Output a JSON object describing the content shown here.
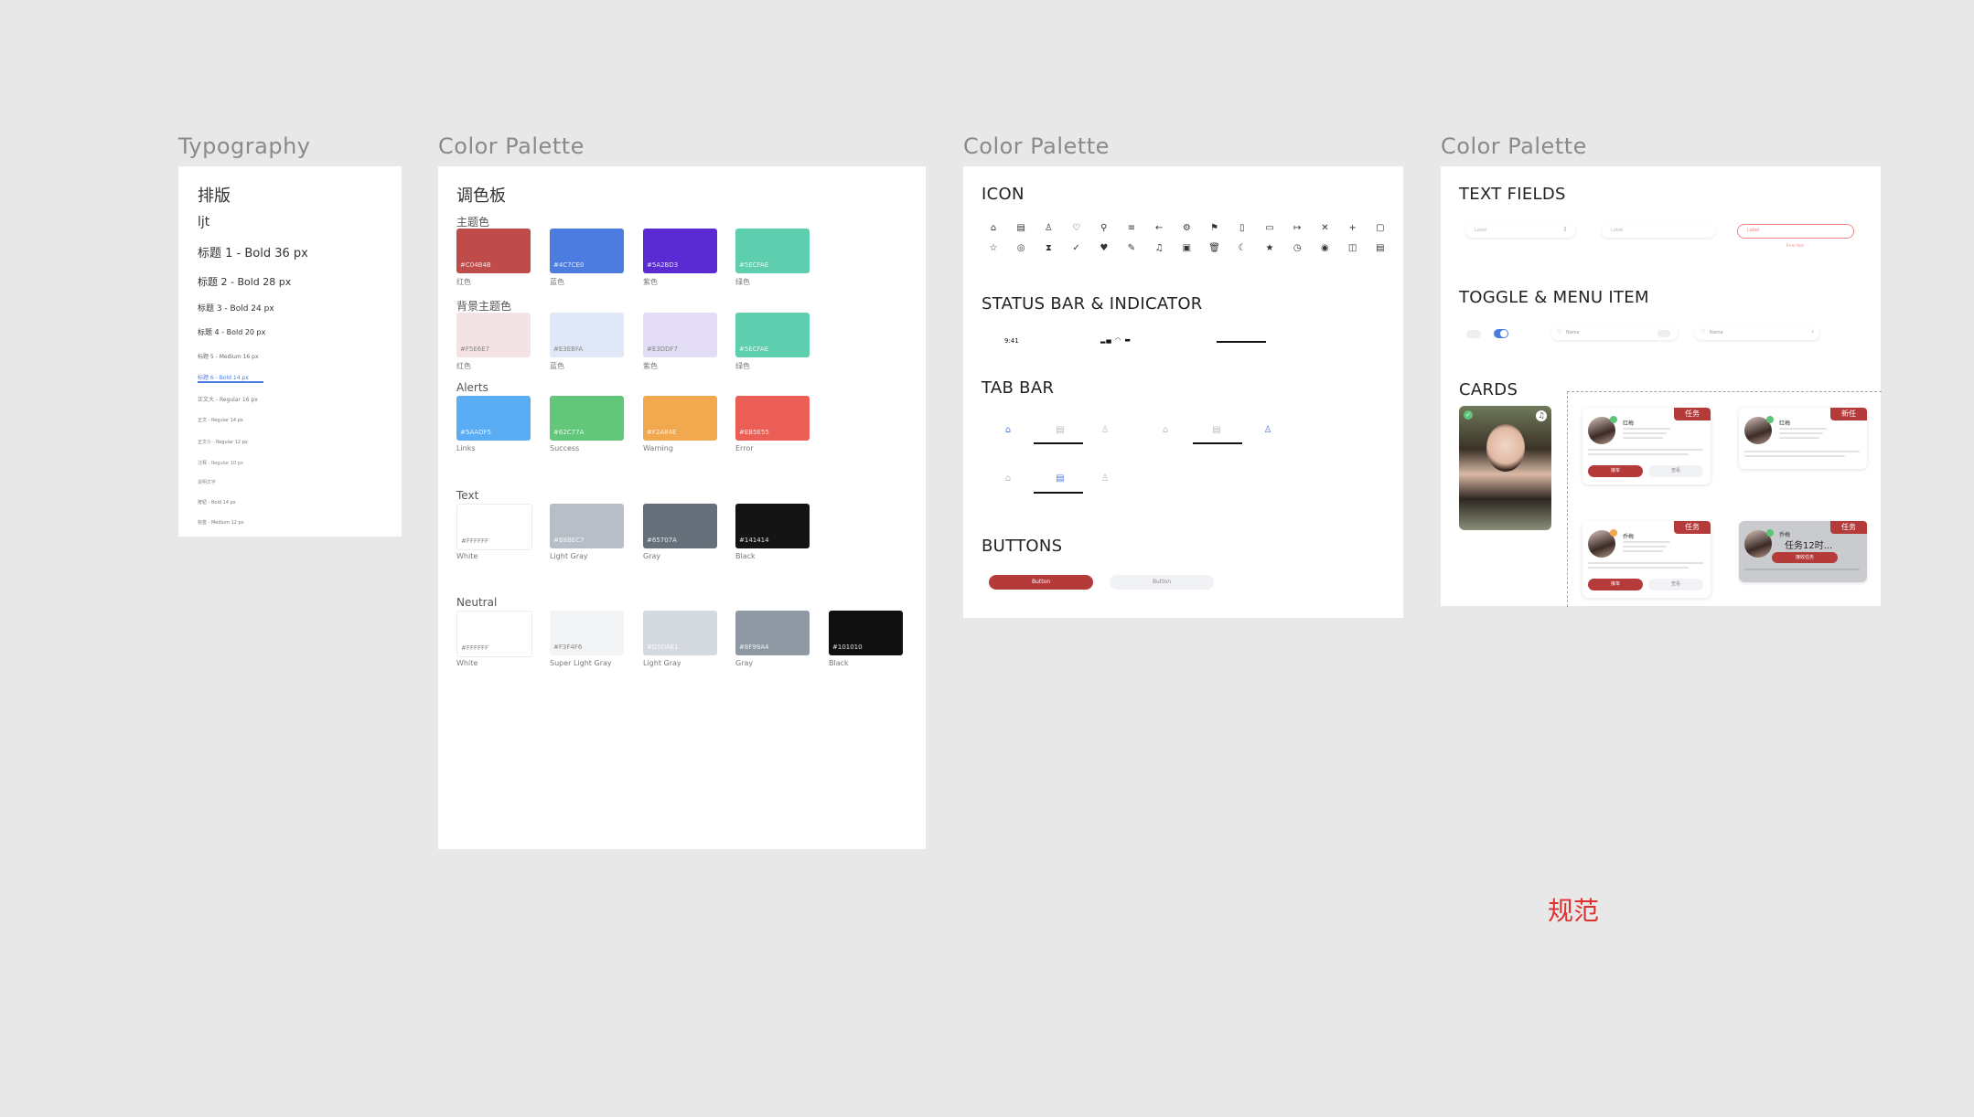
{
  "frames": {
    "typography_title": "Typography",
    "palette_title": "Color Palette",
    "components_title": "Color Palette",
    "forms_title": "Color Palette"
  },
  "typography": {
    "heading": "排版",
    "sample": "ljt",
    "lines": [
      "标题 1 - Bold 36 px",
      "标题 2 - Bold 28 px",
      "标题 3 - Bold 24 px",
      "标题 4 - Bold 20 px",
      "标题 5 - Medium 16 px",
      "标题 6 - Bold 14 px",
      "正文大 - Regular 16 px",
      "正文 - Regular 14 px",
      "正文小 - Regular 12 px",
      "注释 - Regular 10 px",
      "说明文字",
      "按钮 - Bold 14 px",
      "标签 - Medium 12 px"
    ]
  },
  "palette": {
    "heading": "调色板",
    "sections": [
      {
        "label": "主题色",
        "swatches": [
          {
            "hex": "#C04B4B",
            "name": "红色",
            "color": "#c04b4b"
          },
          {
            "hex": "#4C7CE0",
            "name": "蓝色",
            "color": "#4c7ce0"
          },
          {
            "hex": "#5A2BD3",
            "name": "紫色",
            "color": "#5a2bd3"
          },
          {
            "hex": "#5ECFAE",
            "name": "绿色",
            "color": "#5ecfae"
          }
        ]
      },
      {
        "label": "背景主题色",
        "swatches": [
          {
            "hex": "#F5E6E7",
            "name": "红色",
            "color": "#f3e3e4"
          },
          {
            "hex": "#E3EBFA",
            "name": "蓝色",
            "color": "#e0e8f7"
          },
          {
            "hex": "#E3DDF7",
            "name": "紫色",
            "color": "#e2dcf4"
          },
          {
            "hex": "#5ECFAE",
            "name": "绿色",
            "color": "#5ecfae"
          }
        ]
      },
      {
        "label": "Alerts",
        "swatches": [
          {
            "hex": "#5AADF5",
            "name": "Links",
            "color": "#5aadf5"
          },
          {
            "hex": "#62C77A",
            "name": "Success",
            "color": "#62c77a"
          },
          {
            "hex": "#F2A84E",
            "name": "Warning",
            "color": "#f2a84e"
          },
          {
            "hex": "#EB5E55",
            "name": "Error",
            "color": "#eb5e55"
          }
        ]
      },
      {
        "label": "Text",
        "swatches": [
          {
            "hex": "#FFFFFF",
            "name": "White",
            "color": "#ffffff"
          },
          {
            "hex": "#B8BEC7",
            "name": "Light Gray",
            "color": "#b8bec7"
          },
          {
            "hex": "#65707A",
            "name": "Gray",
            "color": "#65707a"
          },
          {
            "hex": "#141414",
            "name": "Black",
            "color": "#141414"
          }
        ]
      },
      {
        "label": "Neutral",
        "swatches": [
          {
            "hex": "#FFFFFF",
            "name": "White",
            "color": "#ffffff"
          },
          {
            "hex": "#F3F4F6",
            "name": "Super Light Gray",
            "color": "#f3f4f6"
          },
          {
            "hex": "#D5DAE1",
            "name": "Light Gray",
            "color": "#d5dae1"
          },
          {
            "hex": "#8F99A4",
            "name": "Gray",
            "color": "#8f99a4"
          },
          {
            "hex": "#101010",
            "name": "Black",
            "color": "#101010"
          }
        ]
      }
    ]
  },
  "components": {
    "icon_heading": "ICON",
    "status_heading": "STATUS BAR & INDICATOR",
    "status_time": "9:41",
    "tab_heading": "TAB BAR",
    "buttons_heading": "BUTTONS",
    "primary_button": "Button",
    "secondary_button": "Button",
    "icons_row1": [
      "⌂",
      "▤",
      "♙",
      "♡",
      "⚲",
      "≡",
      "←",
      "⚙",
      "⚑",
      "▯",
      "▭",
      "↦",
      "✕",
      "+",
      "▢"
    ],
    "icons_row2": [
      "☆",
      "◎",
      "⧗",
      "✓",
      "♥",
      "✎",
      "♫",
      "▣",
      "🗑",
      "☾",
      "★",
      "◷",
      "◉",
      "◫",
      "▤"
    ]
  },
  "forms": {
    "text_fields_heading": "TEXT FIELDS",
    "field1_placeholder": "Label",
    "field2_placeholder": "Label",
    "field3_placeholder": "Label",
    "field3_error": "Error text",
    "toggle_heading": "TOGGLE & MENU ITEM",
    "menu_item1": "Name",
    "menu_item2": "Name",
    "cards_heading": "CARDS",
    "card_tag": "任务",
    "card_tag2": "新任",
    "card_name1": "红梅",
    "card_name2": "红梅",
    "card_name3": "乔梅",
    "card_name4": "乔梅",
    "card_overlay_text": "任务12时...",
    "card_overlay_button": "接收任务",
    "card_btn_accept": "接单",
    "card_btn_detail": "查看"
  },
  "footer_label": "规范",
  "colors": {
    "accent": "#b53b3b",
    "blue": "#4c7ce0",
    "background": "#e8e8e8",
    "footer": "#e03131"
  }
}
